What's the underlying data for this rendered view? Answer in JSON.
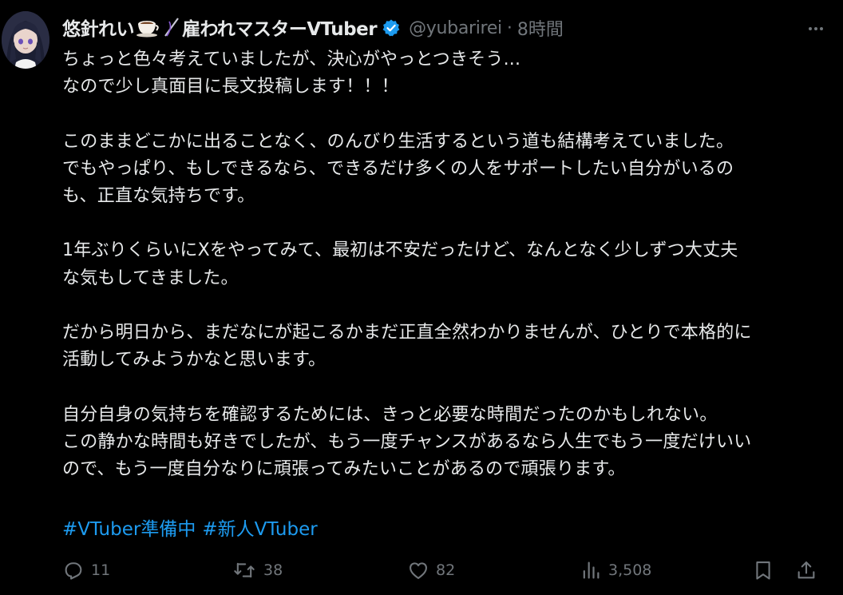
{
  "author": {
    "name_prefix": "悠針れい",
    "name_suffix": "雇われマスターVTuber",
    "handle": "@yubarirei",
    "separator": "·",
    "time": "8時間"
  },
  "body": {
    "paragraphs": [
      "ちょっと色々考えていましたが、決心がやっとつきそう...\nなので少し真面目に長文投稿します！！！",
      "このままどこかに出ることなく、のんびり生活するという道も結構考えていました。\nでもやっぱり、もしできるなら、できるだけ多くの人をサポートしたい自分がいるの\nも、正直な気持ちです。",
      "1年ぶりくらいにXをやってみて、最初は不安だったけど、なんとなく少しずつ大丈夫\nな気もしてきました。",
      "だから明日から、まだなにが起こるかまだ正直全然わかりませんが、ひとりで本格的に\n活動してみようかなと思います。",
      "自分自身の気持ちを確認するためには、きっと必要な時間だったのかもしれない。\nこの静かな時間も好きでしたが、もう一度チャンスがあるなら人生でもう一度だけいい\nので、もう一度自分なりに頑張ってみたいことがあるので頑張ります。"
    ]
  },
  "hashtags": [
    "#VTuber準備中",
    "#新人VTuber"
  ],
  "actions": {
    "replies": "11",
    "retweets": "38",
    "likes": "82",
    "views": "3,508"
  },
  "colors": {
    "background": "#000000",
    "text": "#e7e9ea",
    "muted": "#71767b",
    "link": "#1d9bf0",
    "verified": "#1d9bf0"
  },
  "icons": {
    "name_emoji_1": "coffee-cup-icon",
    "name_emoji_2": "needle-icon",
    "verified": "verified-badge-icon",
    "more": "more-dots-icon",
    "reply": "reply-icon",
    "retweet": "retweet-icon",
    "like": "heart-icon",
    "views": "views-chart-icon",
    "bookmark": "bookmark-icon",
    "share": "share-icon"
  }
}
